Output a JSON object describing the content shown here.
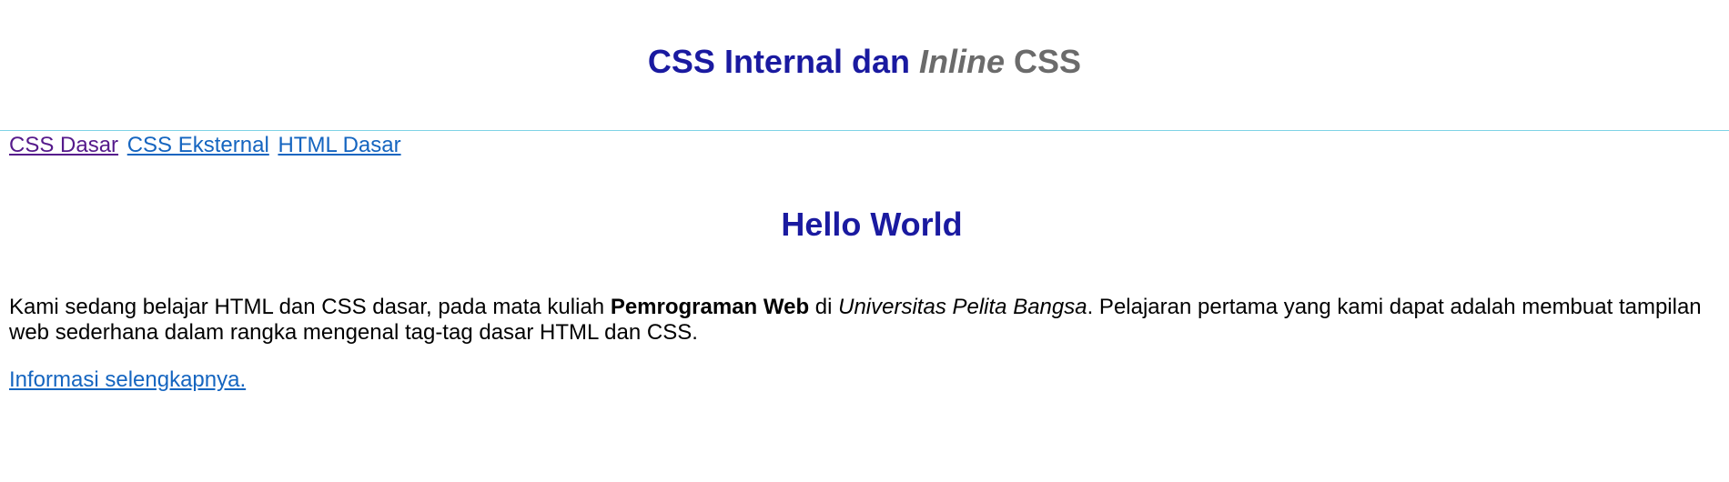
{
  "header": {
    "title_main": "CSS Internal dan",
    "title_accent_italic": "Inline",
    "title_accent": "CSS"
  },
  "nav": {
    "links": [
      {
        "label": "CSS Dasar",
        "state": "visited"
      },
      {
        "label": "CSS Eksternal",
        "state": "unvisited"
      },
      {
        "label": "HTML Dasar",
        "state": "unvisited"
      }
    ]
  },
  "content": {
    "heading": "Hello World",
    "paragraph": {
      "part1": "Kami sedang belajar HTML dan CSS dasar, pada mata kuliah ",
      "bold": "Pemrograman Web",
      "part2": " di ",
      "italic": "Universitas Pelita Bangsa",
      "part3": ". Pelajaran pertama yang kami dapat adalah membuat tampilan web sederhana dalam rangka mengenal tag-tag dasar HTML dan CSS."
    },
    "more_link": "Informasi selengkapnya."
  },
  "colors": {
    "heading": "#1a1aa0",
    "title_accent": "#6b6b6b",
    "divider": "#7fd3e6",
    "link": "#1565c0",
    "link_visited": "#551a8b"
  }
}
